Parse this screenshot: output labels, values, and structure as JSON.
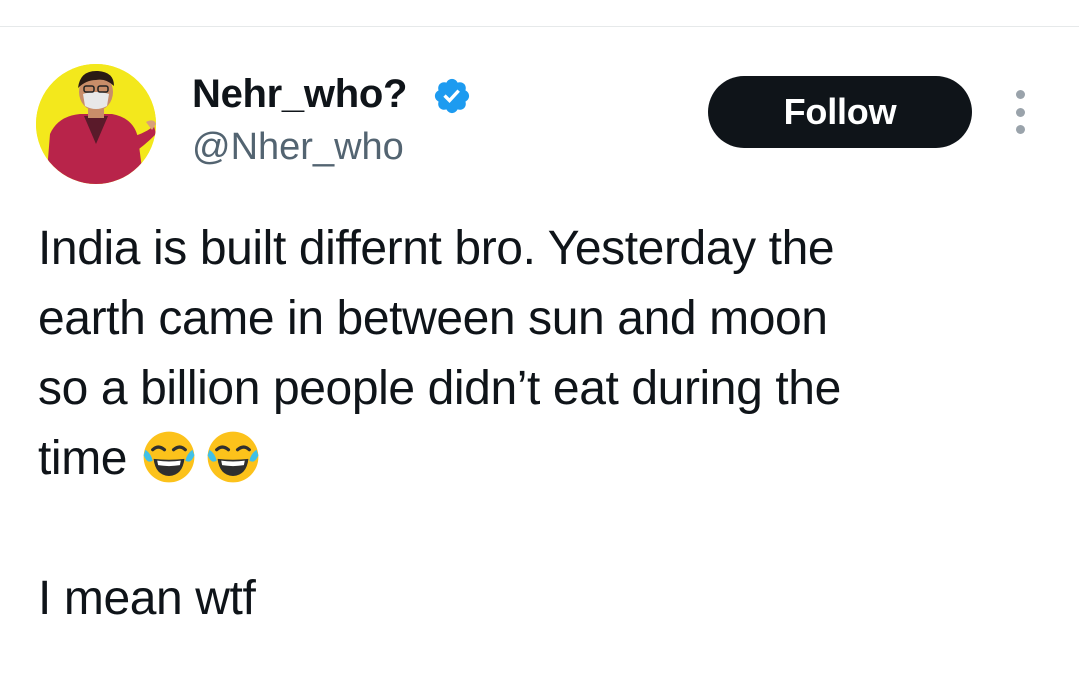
{
  "user": {
    "display_name": "Nehr_who?",
    "handle": "@Nher_who",
    "verified": true,
    "avatar_icon": "user-avatar-photo"
  },
  "actions": {
    "follow_label": "Follow",
    "more_icon": "more-options-icon"
  },
  "tweet": {
    "lines": [
      "India is built differnt bro. Yesterday the",
      "earth came in between sun and moon",
      "so a billion people didn’t eat during the",
      "time"
    ],
    "emojis": [
      "face-with-tears-of-joy",
      "face-with-tears-of-joy"
    ],
    "second_paragraph": "I mean wtf"
  },
  "colors": {
    "text": "#0f1419",
    "secondary_text": "#536471",
    "follow_bg": "#0f1419",
    "verified_blue": "#1d9bf0",
    "avatar_bg": "#f3e81c"
  }
}
